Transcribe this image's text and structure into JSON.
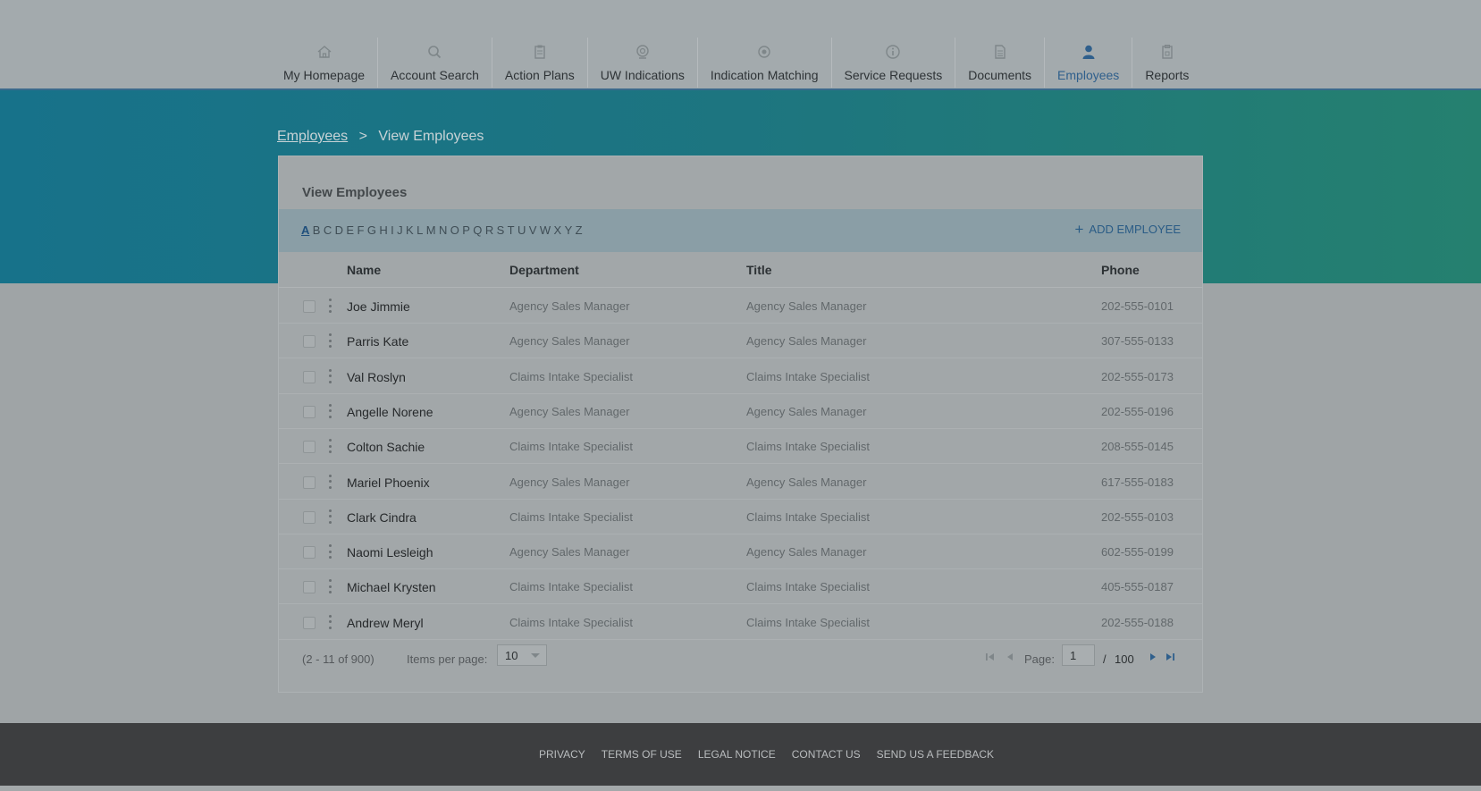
{
  "nav": {
    "items": [
      {
        "label": "My Homepage",
        "icon": "home-icon",
        "active": false
      },
      {
        "label": "Account Search",
        "icon": "search-icon",
        "active": false
      },
      {
        "label": "Action Plans",
        "icon": "clipboard-icon",
        "active": false
      },
      {
        "label": "UW Indications",
        "icon": "indication-icon",
        "active": false
      },
      {
        "label": "Indication Matching",
        "icon": "target-icon",
        "active": false
      },
      {
        "label": "Service Requests",
        "icon": "info-icon",
        "active": false
      },
      {
        "label": "Documents",
        "icon": "document-icon",
        "active": false
      },
      {
        "label": "Employees",
        "icon": "user-icon",
        "active": true
      },
      {
        "label": "Reports",
        "icon": "report-icon",
        "active": false
      }
    ]
  },
  "breadcrumb": {
    "link": "Employees",
    "separator": ">",
    "current": "View Employees"
  },
  "panel": {
    "title": "View Employees",
    "letters": [
      "A",
      "B",
      "C",
      "D",
      "E",
      "F",
      "G",
      "H",
      "I",
      "J",
      "K",
      "L",
      "M",
      "N",
      "O",
      "P",
      "Q",
      "R",
      "S",
      "T",
      "U",
      "V",
      "W",
      "X",
      "Y",
      "Z"
    ],
    "selected_letter": "A",
    "add_button": "ADD EMPLOYEE"
  },
  "table": {
    "headers": {
      "name": "Name",
      "department": "Department",
      "title": "Title",
      "phone": "Phone"
    },
    "rows": [
      {
        "name": "Joe Jimmie",
        "department": "Agency Sales Manager",
        "title": "Agency Sales Manager",
        "phone": "202-555-0101"
      },
      {
        "name": "Parris Kate",
        "department": "Agency Sales Manager",
        "title": "Agency Sales Manager",
        "phone": "307-555-0133"
      },
      {
        "name": "Val Roslyn",
        "department": "Claims Intake Specialist",
        "title": "Claims Intake Specialist",
        "phone": "202-555-0173"
      },
      {
        "name": "Angelle Norene",
        "department": "Agency Sales Manager",
        "title": "Agency Sales Manager",
        "phone": "202-555-0196"
      },
      {
        "name": "Colton Sachie",
        "department": "Claims Intake Specialist",
        "title": "Claims Intake Specialist",
        "phone": "208-555-0145"
      },
      {
        "name": "Mariel Phoenix",
        "department": "Agency Sales Manager",
        "title": "Agency Sales Manager",
        "phone": "617-555-0183"
      },
      {
        "name": "Clark Cindra",
        "department": "Claims Intake Specialist",
        "title": "Claims Intake Specialist",
        "phone": "202-555-0103"
      },
      {
        "name": "Naomi Lesleigh",
        "department": "Agency Sales Manager",
        "title": "Agency Sales Manager",
        "phone": "602-555-0199"
      },
      {
        "name": "Michael Krysten",
        "department": "Claims Intake Specialist",
        "title": "Claims Intake Specialist",
        "phone": "405-555-0187"
      },
      {
        "name": "Andrew Meryl",
        "department": "Claims Intake Specialist",
        "title": "Claims Intake Specialist",
        "phone": "202-555-0188"
      }
    ]
  },
  "pager": {
    "range": "(2 - 11 of 900)",
    "items_per_page_label": "Items per page:",
    "items_per_page": "10",
    "page_label": "Page:",
    "page": "1",
    "slash": "/",
    "total_pages": "100"
  },
  "footer": {
    "links": [
      "PRIVACY",
      "TERMS OF USE",
      "LEGAL NOTICE",
      "CONTACT US",
      "SEND US A FEEDBACK"
    ]
  },
  "colors": {
    "accent": "#2f5f8c",
    "banner_start": "#17728a",
    "banner_end": "#25806f",
    "footer": "#3d3e40"
  }
}
